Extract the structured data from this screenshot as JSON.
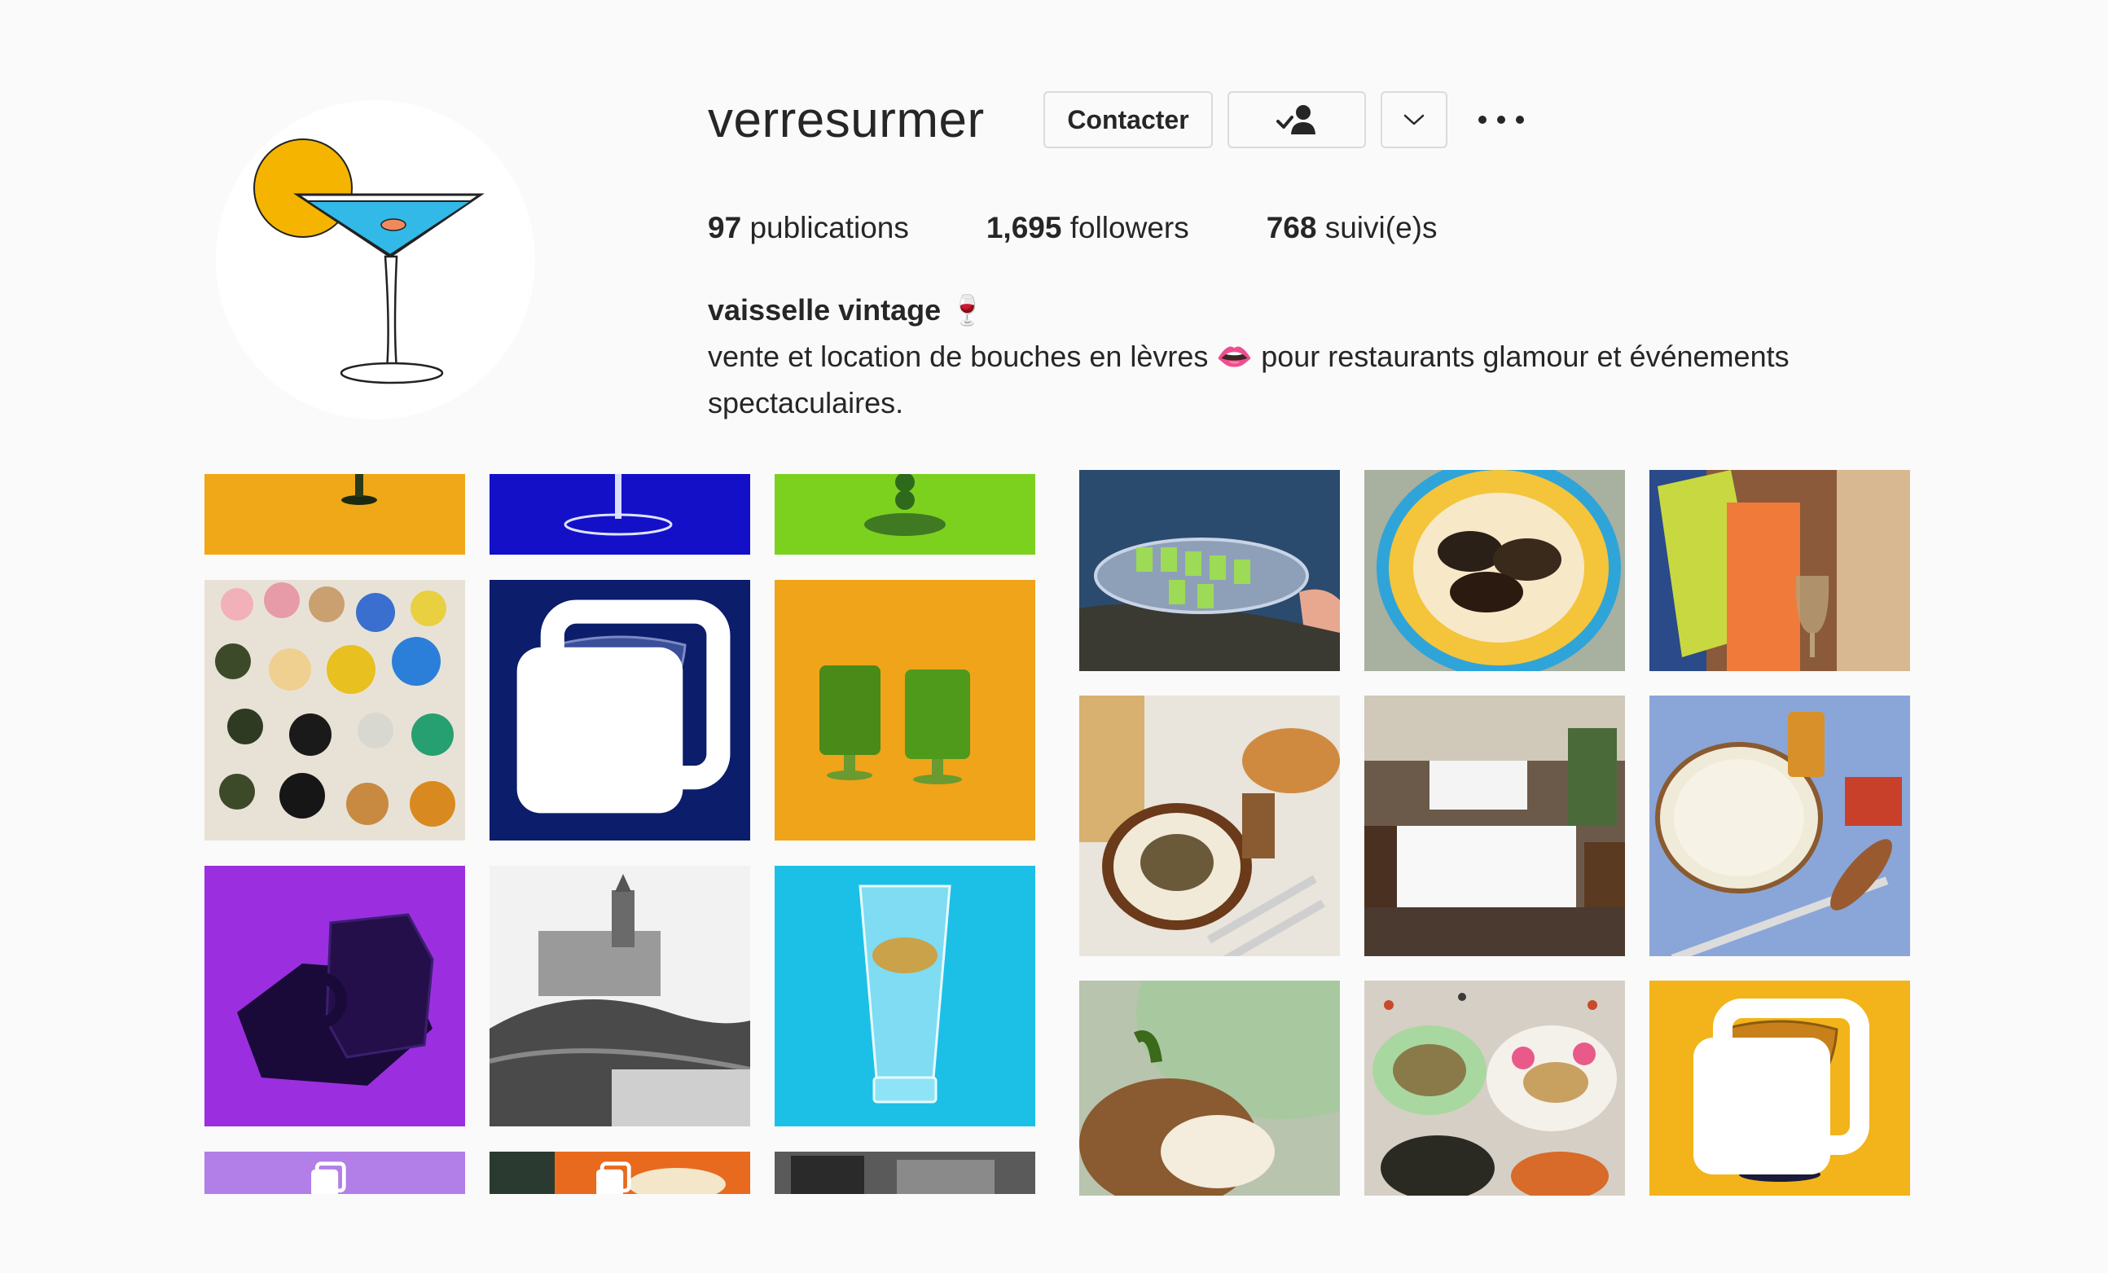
{
  "profile": {
    "username": "verresurmer",
    "avatar_icon": "martini-glass-icon",
    "buttons": {
      "contact": "Contacter",
      "follow_icon": "following-check-icon",
      "more_icon": "chevron-down-icon",
      "options_icon": "more-options-icon"
    },
    "stats": [
      {
        "count": "97",
        "label": "publications"
      },
      {
        "count": "1,695",
        "label": "followers"
      },
      {
        "count": "768",
        "label": "suivi(e)s"
      }
    ],
    "bio": {
      "name": "vaisselle vintage 🍷",
      "line1": "vente et location de bouches en lèvres 👄 pour restaurants glamour et événements",
      "line2": "spectaculaires."
    }
  },
  "colors": {
    "background": "#fafafa",
    "text": "#262626",
    "border": "#dbdbdb",
    "avatar_sun": "#f5b400",
    "avatar_drink": "#33b9e8"
  },
  "grid_left": [
    {
      "desc": "green glass foot on yellow",
      "bg": "#f0a818",
      "multi": false
    },
    {
      "desc": "clear glass foot on blue",
      "bg": "#1410c8",
      "multi": false
    },
    {
      "desc": "green glass stem on lime",
      "bg": "#7cd11f",
      "multi": false
    },
    {
      "desc": "colored glassware flat lay",
      "bg": "#e8e2d6",
      "multi": false
    },
    {
      "desc": "coupe glass on dark blue",
      "bg": "#0b1d6b",
      "multi": true
    },
    {
      "desc": "two green glasses on orange",
      "bg": "#f0a41a",
      "multi": false
    },
    {
      "desc": "black cup and saucer on purple",
      "bg": "#9b2fe0",
      "multi": false
    },
    {
      "desc": "black and white basilica photo",
      "bg": "#c9c9c9",
      "multi": false
    },
    {
      "desc": "beer glass on turquoise",
      "bg": "#1cc0e6",
      "multi": false
    },
    {
      "desc": "lavender tile",
      "bg": "#b27ee8",
      "multi": true
    },
    {
      "desc": "orange tile",
      "bg": "#e86a1e",
      "multi": true
    },
    {
      "desc": "black and white street photo",
      "bg": "#5a5a5a",
      "multi": false
    }
  ],
  "grid_right": [
    {
      "desc": "green shots tray by the sea",
      "bg": "#2a4b6e",
      "multi": false
    },
    {
      "desc": "mussels on yellow plate",
      "bg": "#a8b0a0",
      "multi": false
    },
    {
      "desc": "books and glass",
      "bg": "#8a5a3a",
      "multi": false
    },
    {
      "desc": "table setting with plates",
      "bg": "#e9e4dc",
      "multi": false
    },
    {
      "desc": "restaurant terrace tables",
      "bg": "#6b5a4a",
      "multi": false
    },
    {
      "desc": "plates on blue tablecloth",
      "bg": "#8aa6d8",
      "multi": false
    },
    {
      "desc": "lentil dish on green plate",
      "bg": "#b8c4ae",
      "multi": false
    },
    {
      "desc": "colorful plates on terrazzo",
      "bg": "#d6cfc5",
      "multi": false
    },
    {
      "desc": "amber coupe on yellow",
      "bg": "#f2b41a",
      "multi": true
    }
  ]
}
